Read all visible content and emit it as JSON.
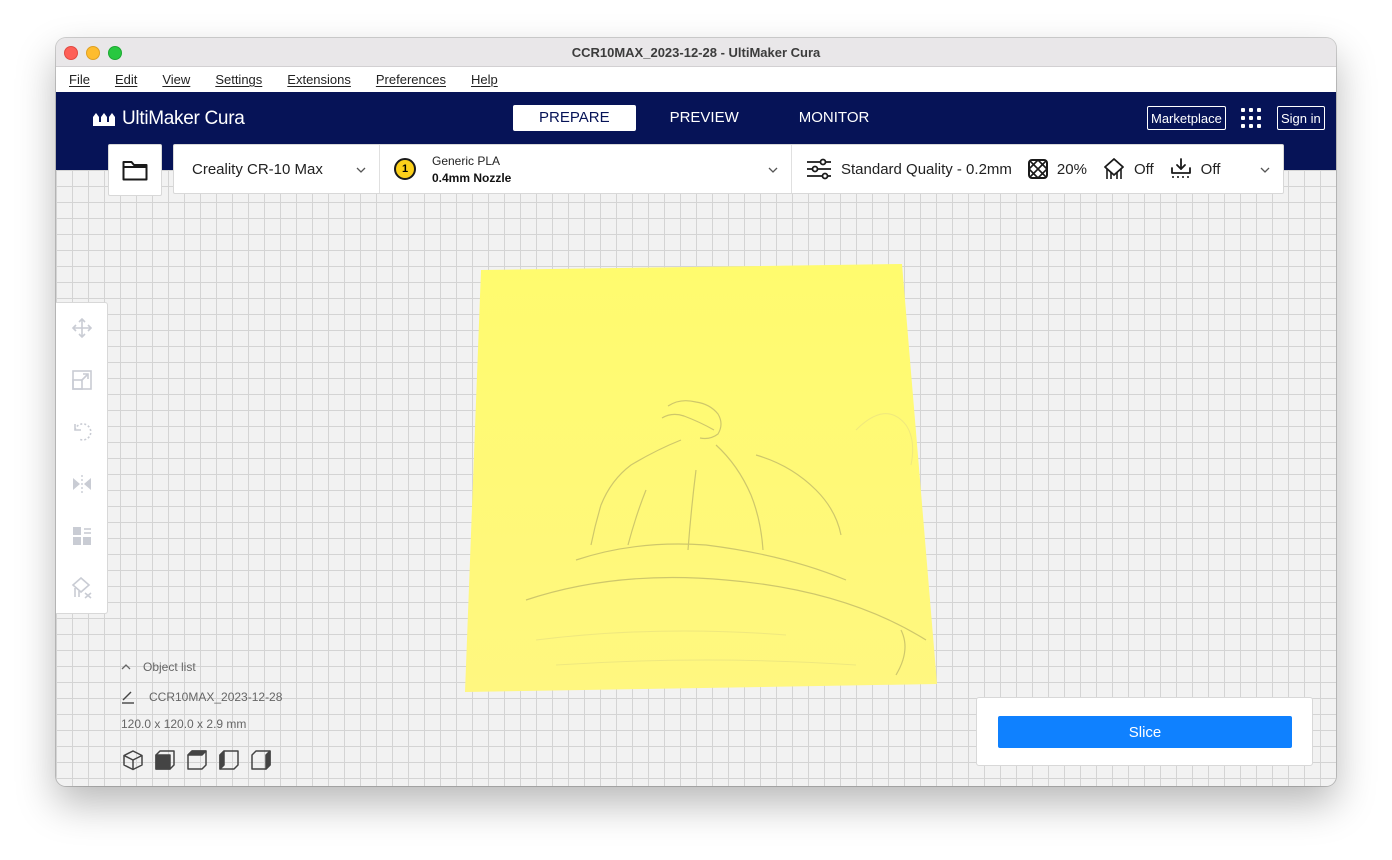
{
  "window": {
    "title": "CCR10MAX_2023-12-28 - UltiMaker Cura"
  },
  "menu": [
    "File",
    "Edit",
    "View",
    "Settings",
    "Extensions",
    "Preferences",
    "Help"
  ],
  "header": {
    "logo_text": "UltiMaker Cura",
    "stages": [
      {
        "label": "PREPARE",
        "active": true
      },
      {
        "label": "PREVIEW",
        "active": false
      },
      {
        "label": "MONITOR",
        "active": false
      }
    ],
    "marketplace_label": "Marketplace",
    "sign_in_label": "Sign in"
  },
  "toolbar": {
    "printer": "Creality CR-10 Max",
    "extruder_number": "1",
    "material": "Generic PLA",
    "nozzle": "0.4mm Nozzle",
    "quality": "Standard Quality - 0.2mm",
    "infill": "20%",
    "support": "Off",
    "adhesion": "Off"
  },
  "object_list": {
    "title": "Object list",
    "object_name": "CCR10MAX_2023-12-28",
    "dimensions": "120.0 x 120.0 x 2.9 mm"
  },
  "slice": {
    "button_label": "Slice"
  },
  "colors": {
    "header_bg": "#061357",
    "accent_blue": "#0f81ff",
    "model_yellow": "#fffb6e",
    "nozzle_badge": "#fcd01a"
  }
}
